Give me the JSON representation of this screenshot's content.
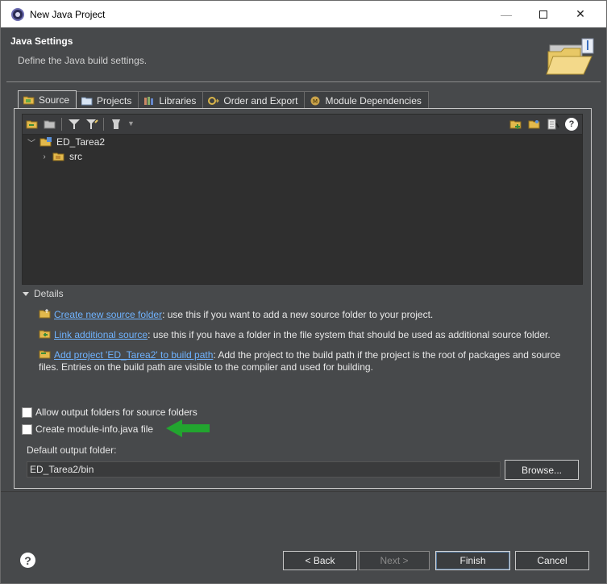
{
  "window": {
    "title": "New Java Project",
    "minimize_glyph": "—",
    "close_glyph": "✕"
  },
  "header": {
    "title": "Java Settings",
    "description": "Define the Java build settings."
  },
  "tabs": [
    {
      "label": "Source",
      "icon": "source-folder-icon",
      "active": true
    },
    {
      "label": "Projects",
      "icon": "projects-icon",
      "active": false
    },
    {
      "label": "Libraries",
      "icon": "libraries-icon",
      "active": false
    },
    {
      "label": "Order and Export",
      "icon": "order-export-icon",
      "active": false
    },
    {
      "label": "Module Dependencies",
      "icon": "module-icon",
      "active": false
    }
  ],
  "tree": {
    "project": "ED_Tarea2",
    "folder": "src"
  },
  "details": {
    "heading": "Details",
    "items": [
      {
        "link": "Create new source folder",
        "text": ": use this if you want to add a new source folder to your project."
      },
      {
        "link": "Link additional source",
        "text": ": use this if you have a folder in the file system that should be used as additional source folder."
      },
      {
        "link": "Add project 'ED_Tarea2' to build path",
        "text": ": Add the project to the build path if the project is the root of packages and source files. Entries on the build path are visible to the compiler and used for building."
      }
    ]
  },
  "options": {
    "allow_output_folders": "Allow output folders for source folders",
    "create_module_info": "Create module-info.java file"
  },
  "output": {
    "label": "Default output folder:",
    "value": "ED_Tarea2/bin",
    "browse": "Browse..."
  },
  "buttons": {
    "back": "< Back",
    "next": "Next >",
    "finish": "Finish",
    "cancel": "Cancel",
    "help": "?"
  },
  "toolbar": {
    "help": "?"
  },
  "colors": {
    "accent_arrow": "#22a52f",
    "link": "#6fb3ff",
    "background": "#47494b"
  }
}
